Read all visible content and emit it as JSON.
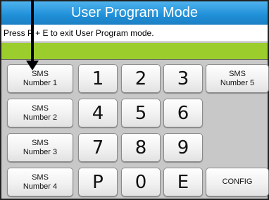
{
  "window": {
    "title": "User Program Mode"
  },
  "message": "Press P + E to exit User Program mode.",
  "keypad": {
    "sms1": {
      "line1": "SMS",
      "line2": "Number 1"
    },
    "sms2": {
      "line1": "SMS",
      "line2": "Number 2"
    },
    "sms3": {
      "line1": "SMS",
      "line2": "Number 3"
    },
    "sms4": {
      "line1": "SMS",
      "line2": "Number 4"
    },
    "sms5": {
      "line1": "SMS",
      "line2": "Number 5"
    },
    "digits": [
      "1",
      "2",
      "3",
      "4",
      "5",
      "6",
      "7",
      "8",
      "9"
    ],
    "p": "P",
    "zero": "0",
    "e": "E",
    "config": "CONFIG"
  },
  "colors": {
    "title_bar": "#1f8fd8",
    "status_bar": "#9bcd2c",
    "keypad_bg": "#c8c8c8"
  }
}
